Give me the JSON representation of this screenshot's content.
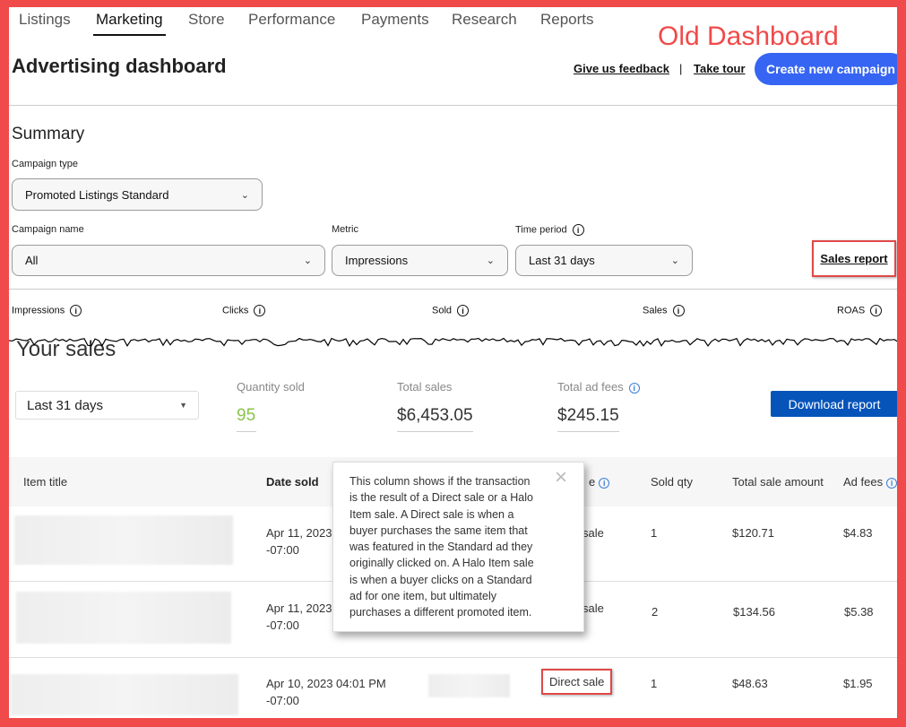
{
  "nav": {
    "tabs": [
      "Listings",
      "Marketing",
      "Store",
      "Performance",
      "Payments",
      "Research",
      "Reports"
    ],
    "active": "Marketing"
  },
  "annotation": {
    "label": "Old Dashboard",
    "color": "#f04a4a"
  },
  "header": {
    "title": "Advertising dashboard",
    "feedback": "Give us feedback",
    "separator": "|",
    "tour": "Take tour",
    "create": "Create new campaign"
  },
  "summary": {
    "title": "Summary",
    "campaign_type_label": "Campaign type",
    "campaign_type": "Promoted Listings Standard",
    "campaign_name_label": "Campaign name",
    "campaign_name": "All",
    "metric_label": "Metric",
    "metric": "Impressions",
    "time_period_label": "Time period",
    "time_period": "Last 31 days",
    "sales_report": "Sales report",
    "metrics": [
      "Impressions",
      "Clicks",
      "Sold",
      "Sales",
      "ROAS"
    ]
  },
  "sales": {
    "title": "Your sales",
    "period": "Last 31 days",
    "quantity_label": "Quantity sold",
    "quantity": "95",
    "total_sales_label": "Total sales",
    "total_sales": "$6,453.05",
    "ad_fees_label": "Total ad fees",
    "ad_fees": "$245.15",
    "download": "Download report",
    "colors": {
      "quantity": "#8bc34a",
      "download": "#0654ba"
    }
  },
  "table": {
    "headers": {
      "item": "Item title",
      "date": "Date sold",
      "sale_type_fragment": "e",
      "qty": "Sold qty",
      "amount": "Total sale amount",
      "fees": "Ad fees"
    },
    "rows": [
      {
        "date": "Apr 11, 2023",
        "tz": "-07:00",
        "sale_type": "sale",
        "qty": "1",
        "amount": "$120.71",
        "fees": "$4.83"
      },
      {
        "date": "Apr 11, 2023",
        "tz": "-07:00",
        "sale_type": "sale",
        "qty": "2",
        "amount": "$134.56",
        "fees": "$5.38"
      },
      {
        "date": "Apr 10, 2023 04:01 PM",
        "tz": "-07:00",
        "sale_type": "Direct sale",
        "qty": "1",
        "amount": "$48.63",
        "fees": "$1.95"
      }
    ]
  },
  "tooltip": {
    "text": "This column shows if the transaction is the result of a Direct sale or a Halo Item sale. A Direct sale is when a buyer purchases the same item that was featured in the Standard ad they originally clicked on. A Halo Item sale is when a buyer clicks on a Standard ad for one item, but ultimately purchases a different promoted item.",
    "close": "×"
  }
}
